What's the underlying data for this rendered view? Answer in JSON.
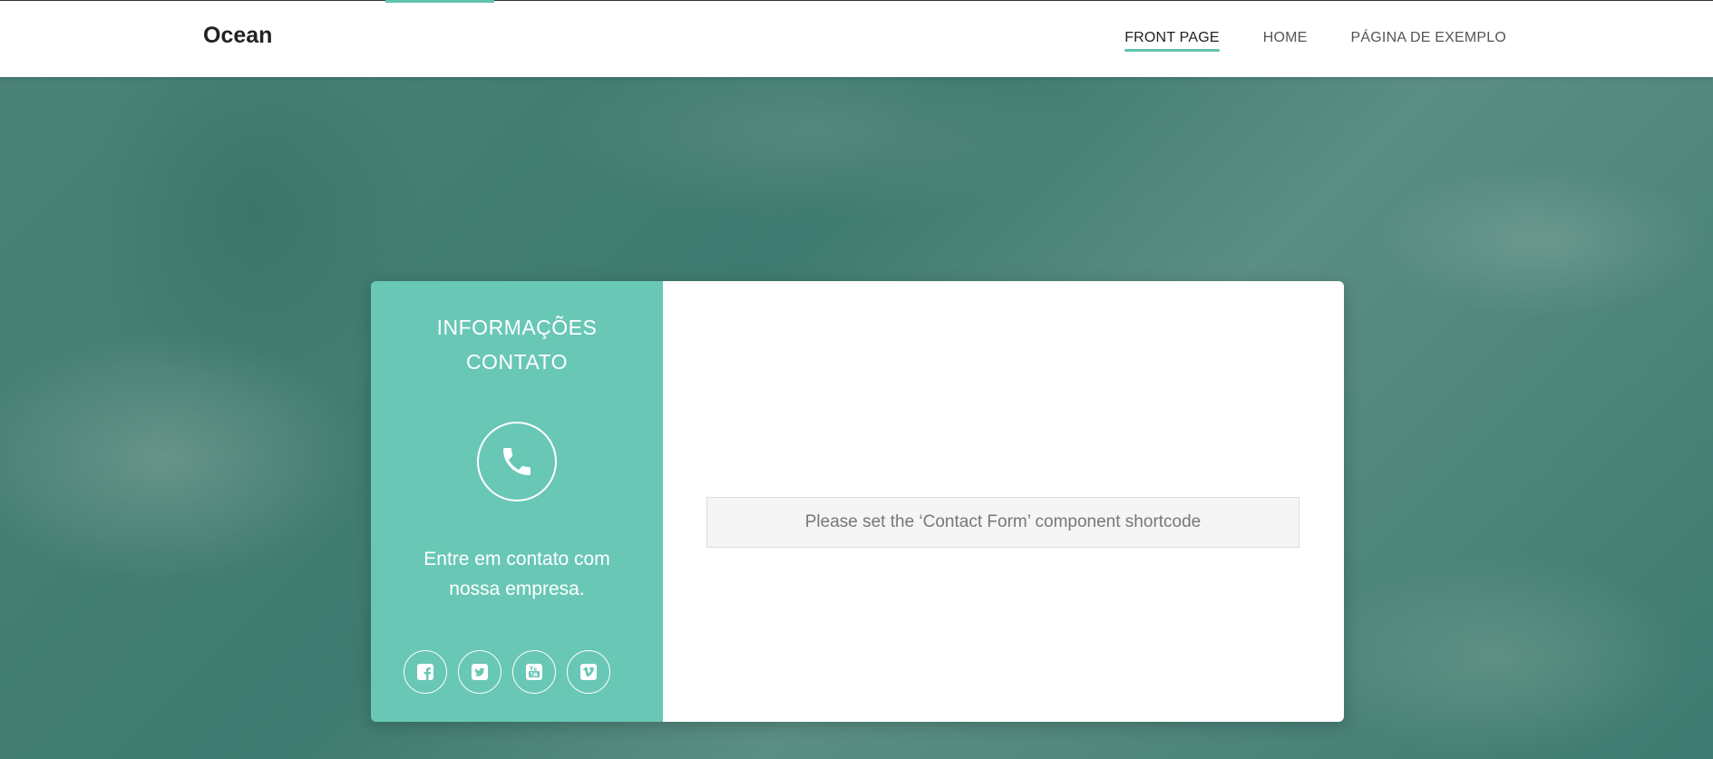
{
  "header": {
    "brand": "Ocean",
    "nav": [
      {
        "label": "FRONT PAGE",
        "active": true
      },
      {
        "label": "HOME",
        "active": false
      },
      {
        "label": "PÁGINA DE EXEMPLO",
        "active": false
      }
    ]
  },
  "contact_card": {
    "title_line1": "INFORMAÇÕES",
    "title_line2": "CONTATO",
    "icon": "phone-icon",
    "text": "Entre em contato com nossa empresa.",
    "social": [
      "facebook-icon",
      "twitter-icon",
      "youtube-icon",
      "vimeo-icon"
    ],
    "form_notice": "Please set the ‘Contact Form’ component shortcode"
  },
  "colors": {
    "accent": "#69c7b6",
    "background": "#3f7a70",
    "header_bg": "#ffffff"
  }
}
